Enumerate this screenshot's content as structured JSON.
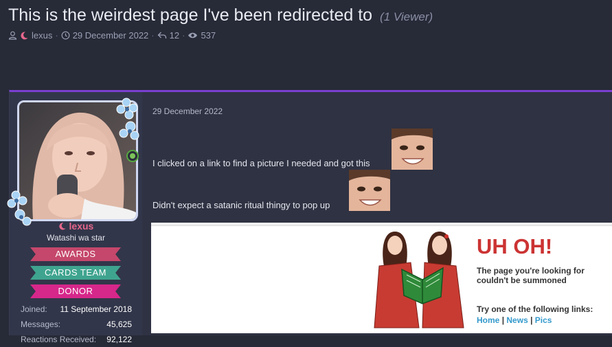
{
  "thread": {
    "title": "This is the weirdest page I've been redirected to",
    "viewers": "(1 Viewer)",
    "author": "lexus",
    "date": "29 December 2022",
    "sep": "·",
    "replies": "12",
    "views": "537"
  },
  "user": {
    "name": "lexus",
    "user_title": "Watashi wa star",
    "banners": [
      {
        "label": "AWARDS",
        "color": "#c5476b"
      },
      {
        "label": "CARDS TEAM",
        "color": "#3fa48f"
      },
      {
        "label": "DONOR",
        "color": "#d6278a"
      }
    ],
    "stats": [
      {
        "label": "Joined:",
        "value": "11 September 2018"
      },
      {
        "label": "Messages:",
        "value": "45,625"
      },
      {
        "label": "Reactions Received:",
        "value": "92,122"
      }
    ]
  },
  "post": {
    "date": "29 December 2022",
    "line1": "I clicked on a link to find a picture I needed and got this",
    "line2": "Didn't expect a satanic ritual thingy to pop up"
  },
  "error_page": {
    "heading": "UH OH!",
    "message": "The page you're looking for couldn't be summoned",
    "try_text": "Try one of the following links:",
    "links": [
      "Home",
      "News",
      "Pics"
    ],
    "divider": "|"
  },
  "colors": {
    "accent": "#7b3fd1",
    "username": "#e6678c",
    "error_red": "#cc3333",
    "link_blue": "#3399cc",
    "online": "#7cc35a"
  },
  "icons": [
    "user-icon",
    "moon-icon",
    "clock-icon",
    "reply-icon",
    "eye-icon",
    "flower-icon"
  ]
}
